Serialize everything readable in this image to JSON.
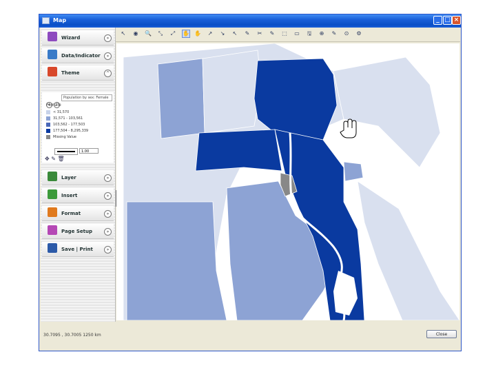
{
  "window": {
    "title": "Map",
    "minimize": "_",
    "maximize": "□",
    "close": "×"
  },
  "sidebar": {
    "sections": [
      {
        "id": "wizard",
        "label": "Wizard",
        "chev": "»",
        "icon_color": "#8e4bbf"
      },
      {
        "id": "data",
        "label": "Data/Indicator",
        "chev": "»",
        "icon_color": "#3a7bc8"
      },
      {
        "id": "theme",
        "label": "Theme",
        "chev": "^",
        "icon_color": "#d8482b"
      },
      {
        "id": "layer",
        "label": "Layer",
        "chev": "»",
        "icon_color": "#3a8a3a"
      },
      {
        "id": "insert",
        "label": "Insert",
        "chev": "»",
        "icon_color": "#3c9a3a"
      },
      {
        "id": "format",
        "label": "Format",
        "chev": "»",
        "icon_color": "#e07a1e"
      },
      {
        "id": "pagesetup",
        "label": "Page Setup",
        "chev": "»",
        "icon_color": "#b548b5"
      },
      {
        "id": "saveprint",
        "label": "Save | Print",
        "chev": "»",
        "icon_color": "#2c5aa8"
      }
    ],
    "theme": {
      "dropdown": "Population by sex: Female",
      "legend_title": "Female",
      "legend": [
        {
          "label": "< 31,570",
          "color": "#c8d3ea"
        },
        {
          "label": "31,571 - 103,561",
          "color": "#8da3d4"
        },
        {
          "label": "103,562 - 177,503",
          "color": "#4a68b8"
        },
        {
          "label": "177,504 - 8,295,339",
          "color": "#0a3aa0"
        },
        {
          "label": "Missing Value",
          "color": "#888888"
        }
      ],
      "line_width": "1.00"
    }
  },
  "toolbar": {
    "tools": [
      "↖",
      "◉",
      "🔍",
      "⤡",
      "⤢",
      "✋",
      "✋",
      "↗",
      "↘",
      "↖",
      "✎",
      "✂",
      "✎",
      "⬚",
      "▭",
      "🖫",
      "⊕",
      "✎",
      "⊙",
      "⚙"
    ]
  },
  "map": {
    "colors": {
      "lightest": "#d9e0ef",
      "light": "#c8d3ea",
      "mid": "#8da3d4",
      "dark": "#0a3aa0",
      "missing": "#888888",
      "nile": "#ffffff"
    }
  },
  "status": {
    "coords": "30.7095 , 30.7005   1250 km",
    "close_label": "Close"
  }
}
